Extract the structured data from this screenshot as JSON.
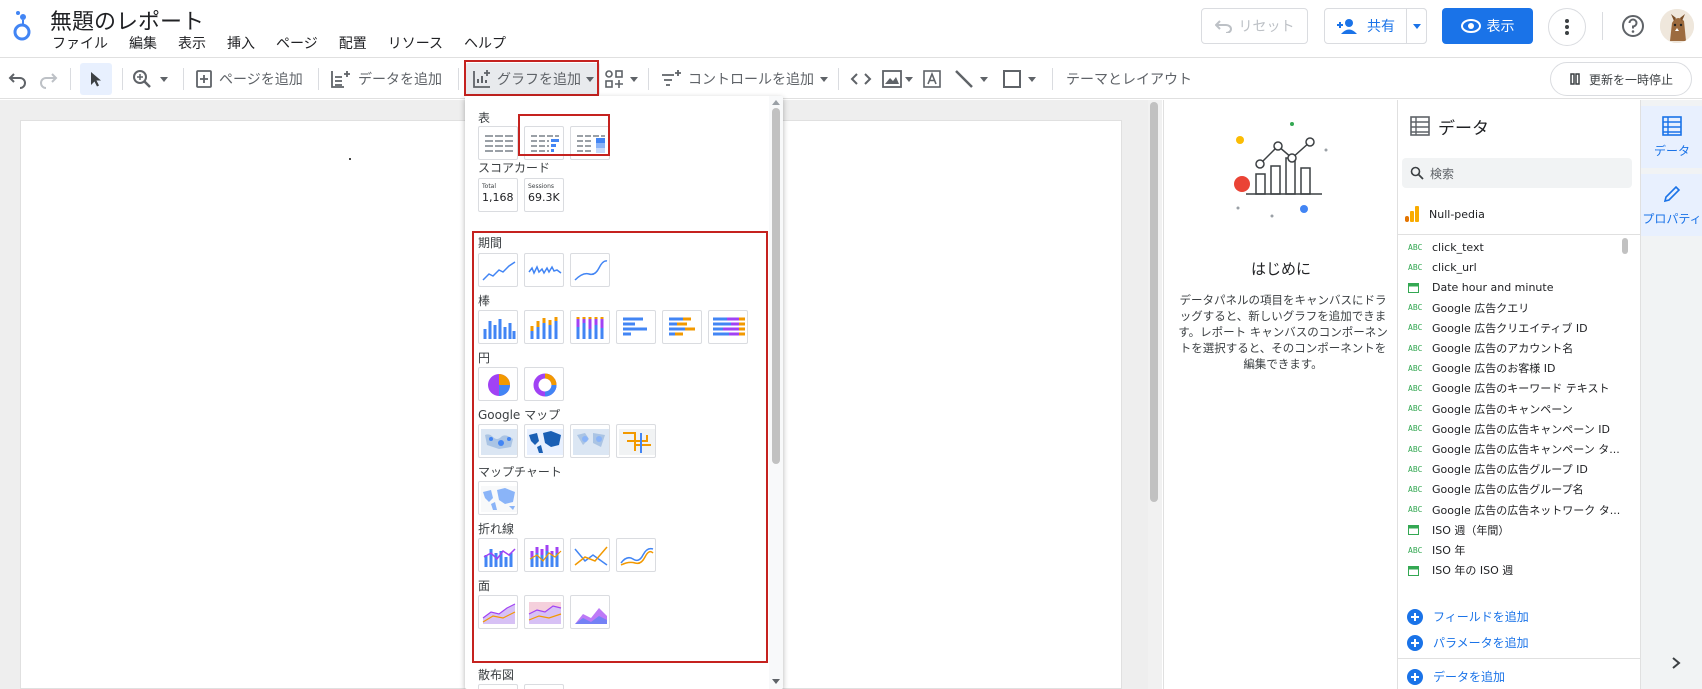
{
  "header": {
    "title": "無題のレポート",
    "menu": [
      "ファイル",
      "編集",
      "表示",
      "挿入",
      "ページ",
      "配置",
      "リソース",
      "ヘルプ"
    ],
    "reset_label": "リセット",
    "share_label": "共有",
    "view_label": "表示"
  },
  "toolbar": {
    "add_page": "ページを追加",
    "add_data": "データを追加",
    "add_chart": "グラフを追加",
    "add_control": "コントロールを追加",
    "theme_layout": "テーマとレイアウト",
    "pause_update": "更新を一時停止"
  },
  "chart_menu": {
    "sections": {
      "table": "表",
      "scorecard": "スコアカード",
      "timeseries": "期間",
      "bar": "棒",
      "pie": "円",
      "google_maps": "Google マップ",
      "map_chart": "マップチャート",
      "line": "折れ線",
      "area": "面",
      "scatter": "散布図"
    },
    "scorecards": [
      {
        "label": "Total",
        "value": "1,168"
      },
      {
        "label": "Sessions",
        "value": "69.3K"
      }
    ]
  },
  "empty_panel": {
    "heading": "はじめに",
    "body": "データパネルの項目をキャンバスにドラッグすると、新しいグラフを追加できます。レポート キャンバスのコンポーネントを選択すると、そのコンポーネントを編集できます。"
  },
  "data_panel": {
    "title": "データ",
    "search_placeholder": "検索",
    "source": "Null-pedia",
    "fields": [
      {
        "type": "ABC",
        "name": "click_text"
      },
      {
        "type": "ABC",
        "name": "click_url"
      },
      {
        "type": "DATE",
        "name": "Date hour and minute"
      },
      {
        "type": "ABC",
        "name": "Google 広告クエリ"
      },
      {
        "type": "ABC",
        "name": "Google 広告クリエイティブ ID"
      },
      {
        "type": "ABC",
        "name": "Google 広告のアカウント名"
      },
      {
        "type": "ABC",
        "name": "Google 広告のお客様 ID"
      },
      {
        "type": "ABC",
        "name": "Google 広告のキーワード テキスト"
      },
      {
        "type": "ABC",
        "name": "Google 広告のキャンペーン"
      },
      {
        "type": "ABC",
        "name": "Google 広告の広告キャンペーン ID"
      },
      {
        "type": "ABC",
        "name": "Google 広告の広告キャンペーン タ..."
      },
      {
        "type": "ABC",
        "name": "Google 広告の広告グループ ID"
      },
      {
        "type": "ABC",
        "name": "Google 広告の広告グループ名"
      },
      {
        "type": "ABC",
        "name": "Google 広告の広告ネットワーク タ..."
      },
      {
        "type": "DATE",
        "name": "ISO 週（年間）"
      },
      {
        "type": "ABC",
        "name": "ISO 年"
      },
      {
        "type": "DATE",
        "name": "ISO 年の ISO 週"
      }
    ],
    "add_field": "フィールドを追加",
    "add_parameter": "パラメータを追加",
    "add_data": "データを追加"
  },
  "right_rail": {
    "data_tab": "データ",
    "properties_tab": "プロパティ"
  },
  "colors": {
    "accent": "#1a73e8",
    "highlight_red": "#c5221f",
    "chart_blue": "#4285f4",
    "chart_orange": "#f29900",
    "chart_purple": "#a142f4"
  }
}
